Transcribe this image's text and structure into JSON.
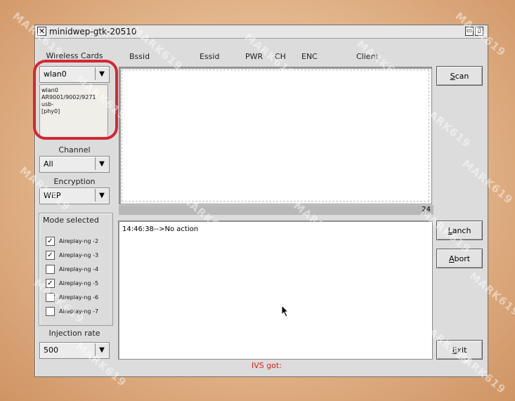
{
  "window": {
    "title": "minidwep-gtk-20510",
    "close_glyph": "✕",
    "buttons": [
      "▭",
      "▯"
    ]
  },
  "left": {
    "wireless_cards_label": "Wireless Cards",
    "card_selected": "wlan0",
    "card_info": [
      "wlan0",
      "AR9001/9002/9271 usb-",
      "[phy0]"
    ],
    "channel_label": "Channel",
    "channel_value": "All",
    "encryption_label": "Encryption",
    "encryption_value": "WEP",
    "mode_label": "Mode selected",
    "modes": [
      {
        "label": "Aireplay-ng -2",
        "checked": true
      },
      {
        "label": "Aireplay-ng -3",
        "checked": true
      },
      {
        "label": "Aireplay-ng -4",
        "checked": false
      },
      {
        "label": "Aireplay-ng -5",
        "checked": true
      },
      {
        "label": "Aireplay-ng -6",
        "checked": false
      },
      {
        "label": "Aireplay-ng -7",
        "checked": false
      }
    ],
    "injection_label": "Injection rate",
    "injection_value": "500"
  },
  "columns": [
    "Bssid",
    "Essid",
    "PWR",
    "CH",
    "ENC",
    "Client"
  ],
  "status_count": "24",
  "log": {
    "line1": "14:46:38-->No action"
  },
  "buttons": {
    "scan_underline": "S",
    "scan_rest": "can",
    "lanch_underline": "L",
    "lanch_rest": "anch",
    "abort_underline": "A",
    "abort_rest": "bort",
    "exit_underline": "E",
    "exit_rest": "xit"
  },
  "ivs_label": "IVS got:",
  "watermark_text": "MARK619",
  "colors": {
    "highlight": "#d22835",
    "ivs": "#e02020"
  }
}
